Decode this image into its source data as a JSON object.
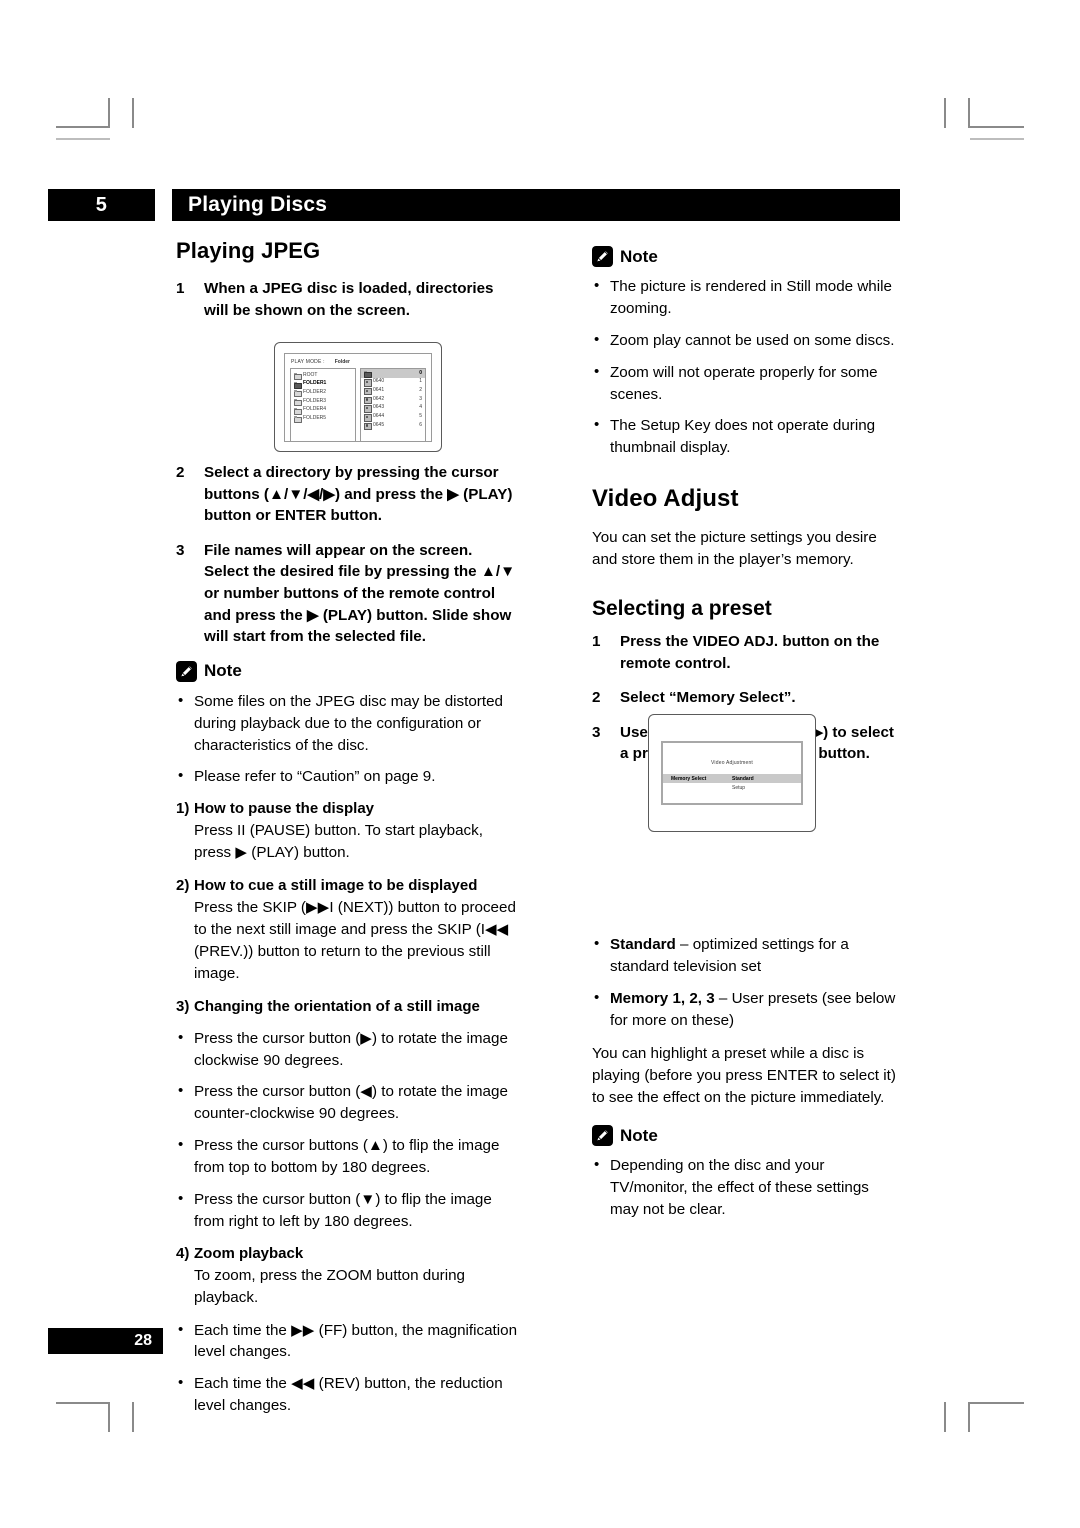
{
  "header": {
    "chapter_number": "5",
    "chapter_title": "Playing Discs"
  },
  "footer": {
    "page_number": "28"
  },
  "left_column": {
    "section_title": "Playing JPEG",
    "steps": [
      {
        "n": "1",
        "text": "When a JPEG disc is loaded, directories will be shown on the screen."
      },
      {
        "n": "2",
        "text": "Select a directory by pressing the cursor buttons (▲/▼/◀/▶) and press the ▶ (PLAY) button or ENTER button."
      },
      {
        "n": "3",
        "text": "File names will appear on the screen. Select the desired file by pressing the ▲/▼ or number buttons of the remote control and press the ▶ (PLAY) button. Slide show will start from the selected file."
      }
    ],
    "note": {
      "label": "Note",
      "bullets": [
        "Some files on the JPEG disc may be distorted during playback due to the configuration or characteristics of the disc.",
        "Please refer to “Caution” on page 9."
      ]
    },
    "subitems": [
      {
        "n": "1)",
        "heading": "How to pause the display",
        "body": "Press II (PAUSE) button. To start playback, press ▶ (PLAY) button."
      },
      {
        "n": "2)",
        "heading": "How to cue a still image to be displayed",
        "body": "Press the SKIP (▶▶I (NEXT)) button to proceed to the next still image and press the SKIP (I◀◀ (PREV.)) button to return to the previous still image."
      },
      {
        "n": "3)",
        "heading": "Changing the orientation of a still image",
        "body": ""
      }
    ],
    "orientation_bullets": [
      "Press the cursor button (▶) to rotate the image clockwise 90 degrees.",
      "Press the cursor button (◀) to rotate the image counter-clockwise 90 degrees.",
      "Press the cursor buttons (▲) to flip the image from top to bottom by 180 degrees.",
      "Press the cursor button (▼) to flip the image from right to left by 180 degrees."
    ],
    "zoom_item": {
      "n": "4)",
      "heading": "Zoom playback",
      "body": "To zoom, press the ZOOM button during playback."
    },
    "zoom_bullets": [
      "Each time the ▶▶ (FF) button, the magnification level changes.",
      "Each time the ◀◀ (REV) button, the reduction level changes."
    ]
  },
  "right_column": {
    "note_top": {
      "label": "Note",
      "bullets": [
        "The picture is rendered in Still mode while zooming.",
        "Zoom play cannot be used on some discs.",
        "Zoom will not operate properly for some scenes.",
        "The Setup Key does not operate during thumbnail display."
      ]
    },
    "section_title": "Video Adjust",
    "section_intro": "You can set the picture settings you desire and store them in the player’s memory.",
    "subsection_title": "Selecting a preset",
    "steps": [
      {
        "n": "1",
        "text": "Press the VIDEO ADJ. button on the remote control."
      },
      {
        "n": "2",
        "text": "Select “Memory Select”."
      },
      {
        "n": "3",
        "text": "Use the cursor buttons (◀/▶) to select a preset, and press ENTER button."
      }
    ],
    "preset_bullets": [
      {
        "term": "Standard",
        "desc": " – optimized settings for a standard television set"
      },
      {
        "term": "Memory 1, 2, 3",
        "desc": " – User presets (see below for more on these)"
      }
    ],
    "highlight_paragraph": "You can highlight a preset while a disc is playing (before you press ENTER to select it) to see the effect on the picture immediately.",
    "note_bottom": {
      "label": "Note",
      "bullets": [
        "Depending on the disc and your TV/monitor, the effect of these settings may not be clear."
      ]
    }
  },
  "figures": {
    "file_browser": {
      "play_mode_label": "PLAY MODE :",
      "play_mode_value": "Folder",
      "directories": [
        "ROOT",
        "FOLDER1",
        "FOLDER2",
        "FOLDER3",
        "FOLDER4",
        "FOLDER5"
      ],
      "selected_directory": "FOLDER1",
      "files": [
        {
          "name": "",
          "num": "0",
          "type": "folder",
          "selected": true
        },
        {
          "name": "0640",
          "num": "1",
          "type": "file",
          "selected": false
        },
        {
          "name": "0641",
          "num": "2",
          "type": "file",
          "selected": false
        },
        {
          "name": "0642",
          "num": "3",
          "type": "file",
          "selected": false
        },
        {
          "name": "0643",
          "num": "4",
          "type": "file",
          "selected": false
        },
        {
          "name": "0644",
          "num": "5",
          "type": "file",
          "selected": false
        },
        {
          "name": "0645",
          "num": "6",
          "type": "file",
          "selected": false
        }
      ]
    },
    "video_adjustment": {
      "title": "Video Adjustment",
      "row_key": "Memory Select",
      "row_value": "Standard",
      "sub_value": "Setup"
    }
  }
}
